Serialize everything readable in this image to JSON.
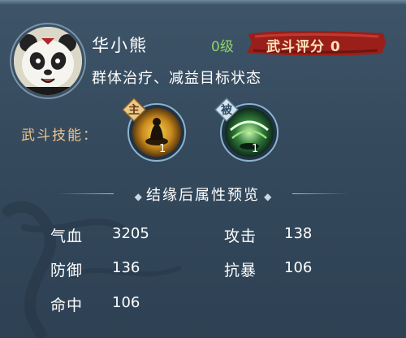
{
  "character": {
    "name": "华小熊",
    "level": "0级",
    "score_label": "武斗评分 0",
    "description": "群体治疗、减益目标状态"
  },
  "skills": {
    "label": "武斗技能：",
    "items": [
      {
        "tag": "主",
        "count": "1",
        "icon": "shadow-silhouette-icon"
      },
      {
        "tag": "被",
        "count": "1",
        "icon": "green-swirl-icon"
      }
    ]
  },
  "section": {
    "title": "结缘后属性预览"
  },
  "stats": [
    {
      "label": "气血",
      "value": "3205"
    },
    {
      "label": "攻击",
      "value": "138"
    },
    {
      "label": "防御",
      "value": "136"
    },
    {
      "label": "抗暴",
      "value": "106"
    },
    {
      "label": "命中",
      "value": "106"
    }
  ],
  "colors": {
    "label_gold": "#f0c48a",
    "level_green": "#8fd36a",
    "score_red": "#a8221c",
    "panel_bg": "#3e5468"
  }
}
